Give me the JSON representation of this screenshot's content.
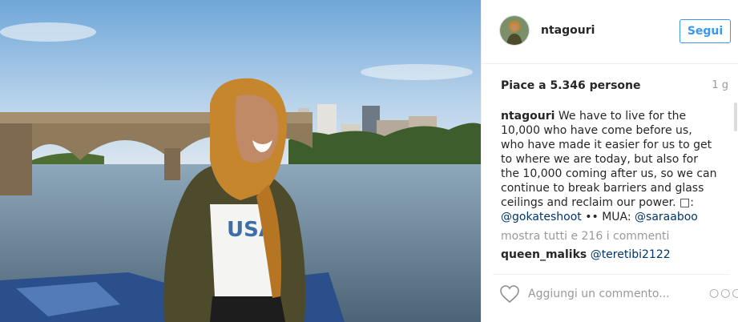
{
  "post": {
    "username": "ntagouri",
    "follow_label": "Segui",
    "likes_text": "Piace a 5.346 persone",
    "age": "1 g",
    "caption": {
      "user": "ntagouri",
      "text": "We have to live for the 10,000 who have come before us, who have made it easier for us to get to where we are today, but also for the 10,000 coming after us, so we can continue to break barriers and glass ceilings and reclaim our power. □: ",
      "photo_credit": "@gokateshoot",
      "mid": " •• MUA: ",
      "mua": "@saraaboo"
    },
    "view_all_comments": "mostra tutti e 216 i commenti",
    "comments": [
      {
        "user": "queen_maliks",
        "text": "@teretibi2122"
      }
    ],
    "add_comment_placeholder": "Aggiungi un commento...",
    "more_options": "○○○"
  },
  "icons": {
    "like": "heart-icon",
    "more": "more-options-icon"
  },
  "colors": {
    "accent": "#3897f0",
    "muted": "#999999",
    "link": "#003569"
  }
}
